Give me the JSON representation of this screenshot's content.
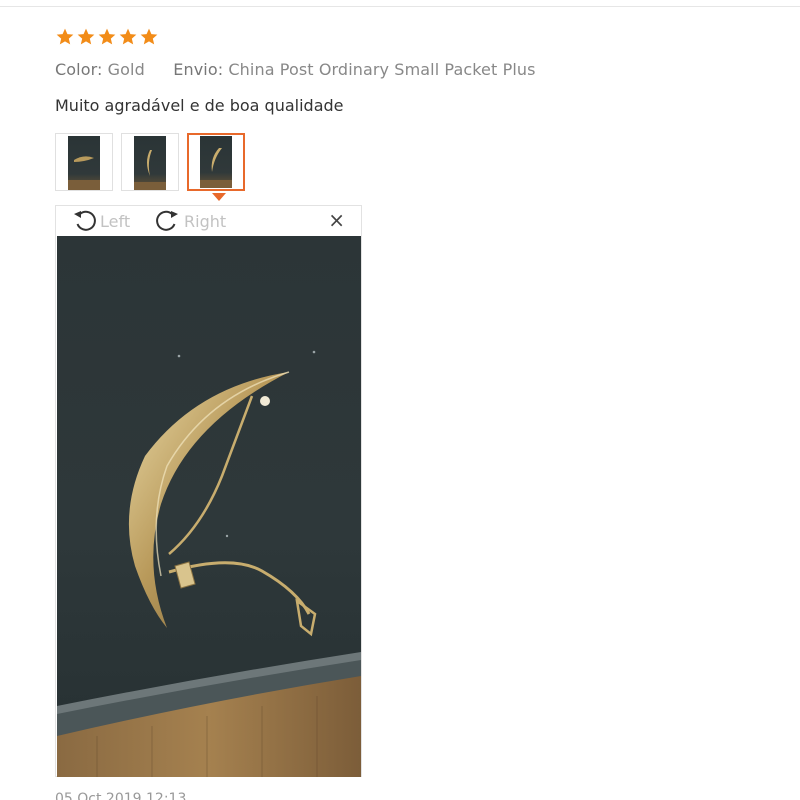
{
  "review": {
    "rating": 5,
    "rating_color": "#f28c18",
    "color_label": "Color:",
    "color_value": "Gold",
    "shipping_label": "Envio:",
    "shipping_value": "China Post Ordinary Small Packet Plus",
    "text": "Muito agradável e de boa qualidade",
    "timestamp": "05 Oct 2019 12:13"
  },
  "thumbnails": [
    {
      "icon": "brooch-photo-thumb-1",
      "selected": false
    },
    {
      "icon": "brooch-photo-thumb-2",
      "selected": false
    },
    {
      "icon": "brooch-photo-thumb-3",
      "selected": true
    }
  ],
  "viewer": {
    "rotate_left_label": "Left",
    "rotate_right_label": "Right",
    "close_glyph": "×",
    "accent_color": "#e8692b"
  }
}
